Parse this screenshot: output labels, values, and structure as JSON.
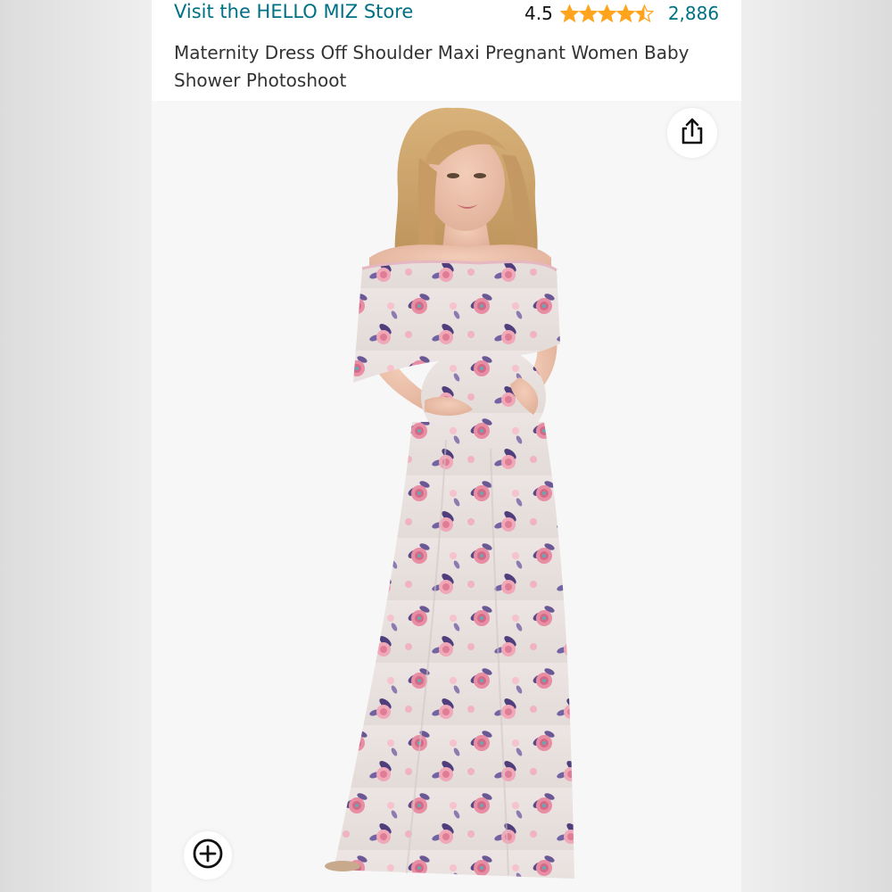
{
  "header": {
    "store_link": "Visit the HELLO MIZ Store",
    "rating_value": "4.5",
    "rating": 4.5,
    "rating_max": 5,
    "review_count": "2,886",
    "star_color": "#ffa41c",
    "link_color": "#007185"
  },
  "product": {
    "title": "Maternity Dress Off Shoulder Maxi Pregnant Women Baby Shower Photoshoot"
  },
  "image_actions": {
    "share_icon": "share-icon",
    "zoom_icon": "zoom-plus-icon"
  }
}
